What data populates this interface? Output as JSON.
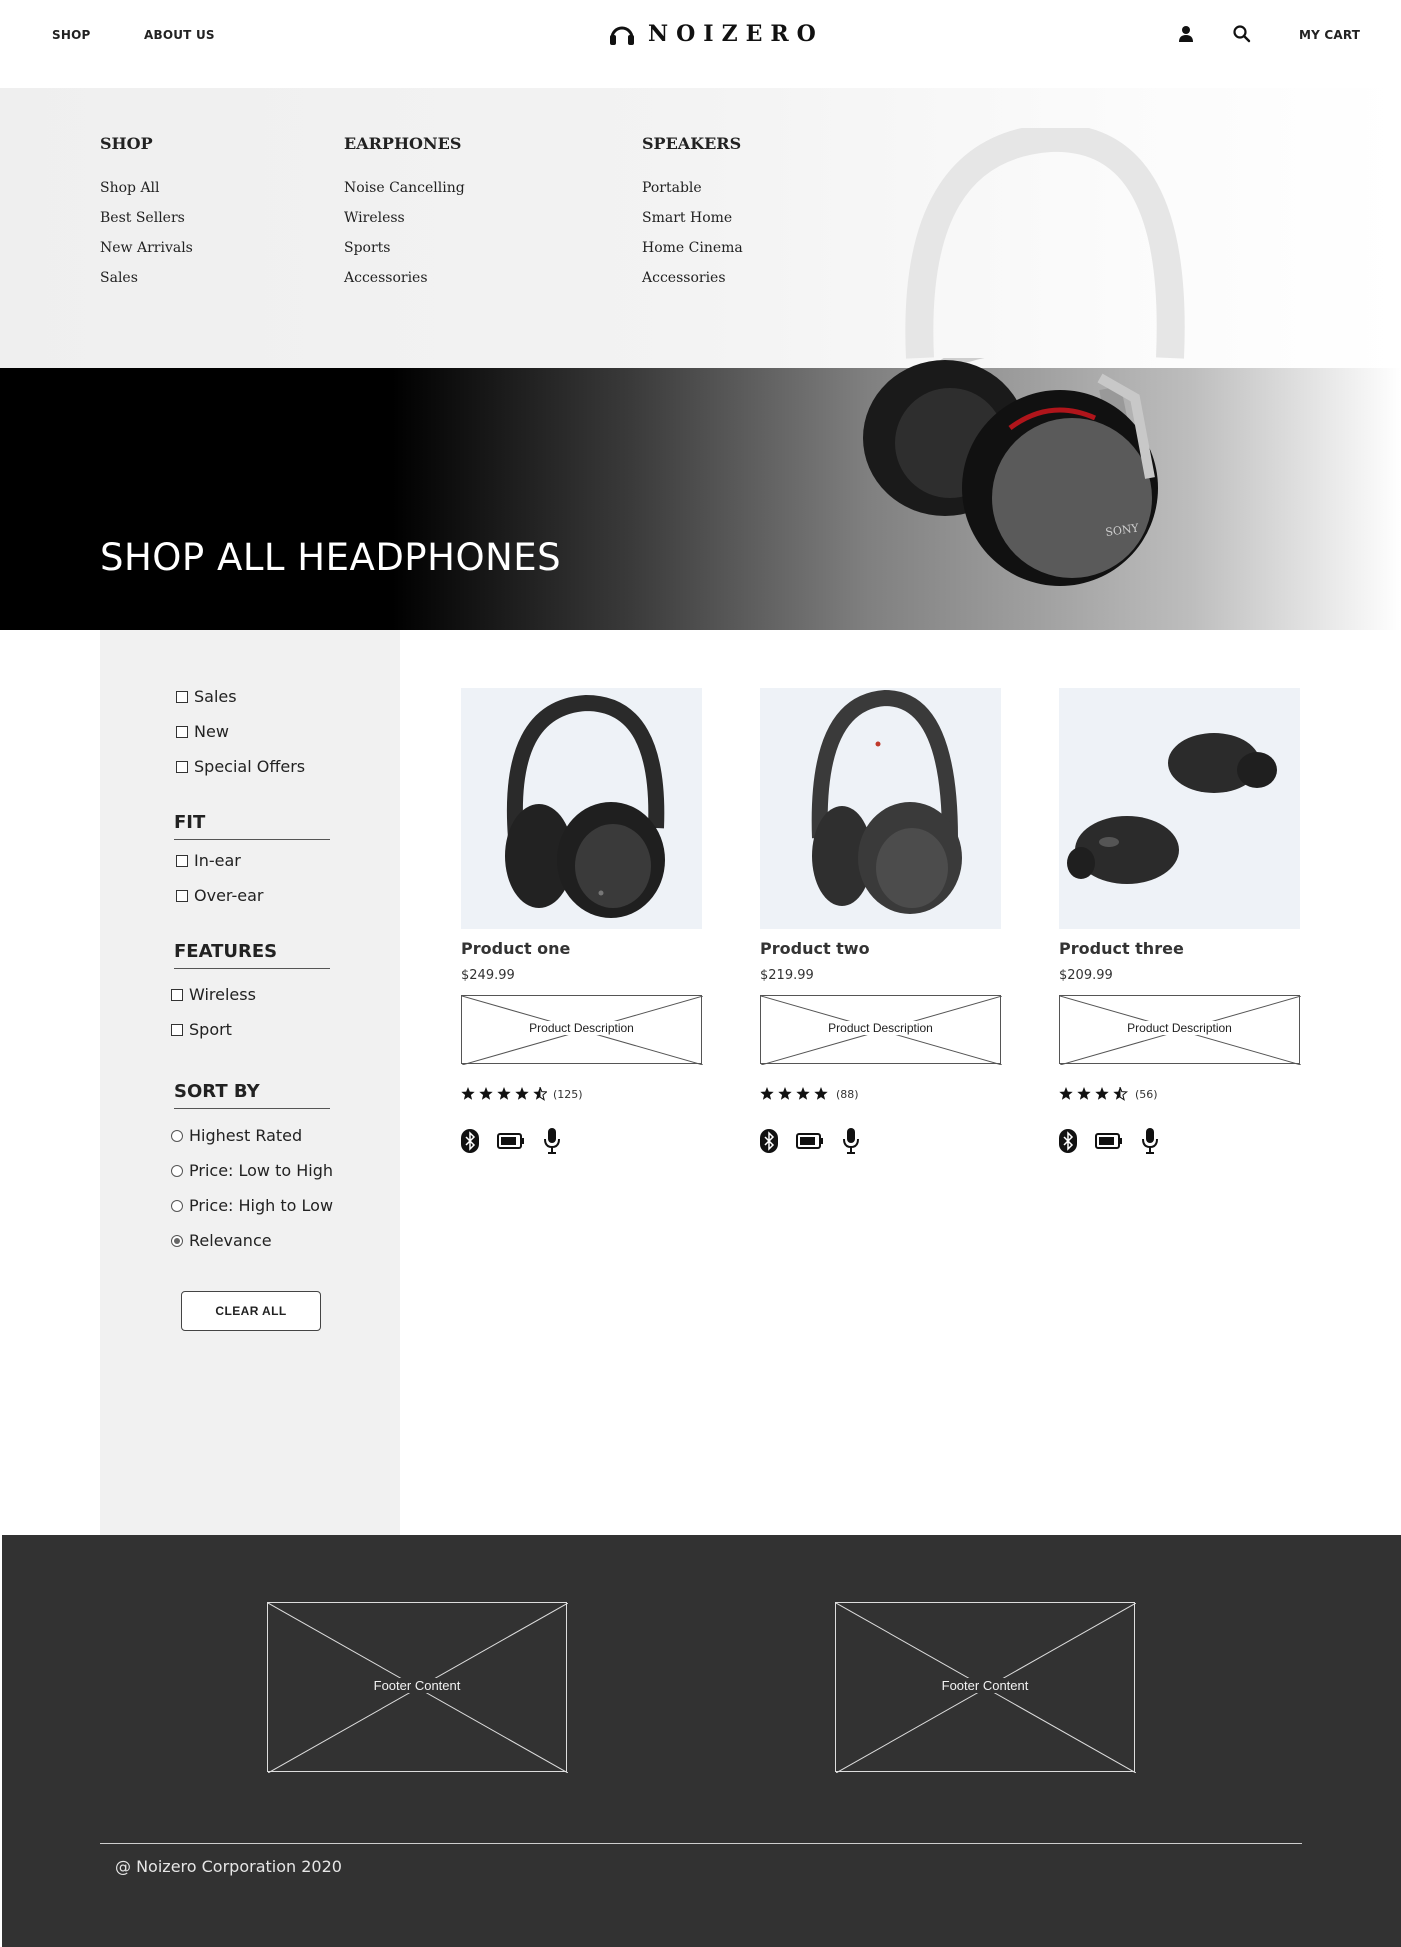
{
  "header": {
    "nav": [
      "SHOP",
      "ABOUT US"
    ],
    "brand": "NOIZERO",
    "cart_label": "MY CART",
    "icons": [
      "user-icon",
      "search-icon"
    ]
  },
  "mega_menu": {
    "columns": [
      {
        "heading": "SHOP",
        "items": [
          "Shop All",
          "Best Sellers",
          "New Arrivals",
          "Sales"
        ]
      },
      {
        "heading": "EARPHONES",
        "items": [
          "Noise Cancelling",
          "Wireless",
          "Sports",
          "Accessories"
        ]
      },
      {
        "heading": "SPEAKERS",
        "items": [
          "Portable",
          "Smart Home",
          "Home Cinema",
          "Accessories"
        ]
      }
    ]
  },
  "hero": {
    "title": "SHOP ALL HEADPHONES",
    "image_text": "SONY"
  },
  "filters": {
    "top": [
      "Sales",
      "New",
      "Special Offers"
    ],
    "fit": {
      "heading": "FIT",
      "options": [
        "In-ear",
        "Over-ear"
      ]
    },
    "features": {
      "heading": "FEATURES",
      "options": [
        "Wireless",
        "Sport"
      ]
    },
    "sort": {
      "heading": "SORT BY",
      "options": [
        "Highest Rated",
        "Price: Low to High",
        "Price: High to Low",
        "Relevance"
      ],
      "selected": "Relevance"
    },
    "clear_label": "CLEAR ALL"
  },
  "products": [
    {
      "name": "Product one",
      "price": "$249.99",
      "description": "Product Description",
      "rating": 4.5,
      "reviews": "(125)"
    },
    {
      "name": "Product two",
      "price": "$219.99",
      "description": "Product Description",
      "rating": 4,
      "reviews": "(88)"
    },
    {
      "name": "Product three",
      "price": "$209.99",
      "description": "Product Description",
      "rating": 3.5,
      "reviews": "(56)"
    }
  ],
  "feature_icons": [
    "bluetooth-icon",
    "battery-icon",
    "microphone-icon"
  ],
  "footer": {
    "boxes": [
      "Footer Content",
      "Footer Content"
    ],
    "copyright": "@ Noizero Corporation 2020"
  },
  "colors": {
    "footer_bg": "#323232",
    "sidebar_bg": "#f1f1f1",
    "card_bg": "#eef2f7"
  }
}
